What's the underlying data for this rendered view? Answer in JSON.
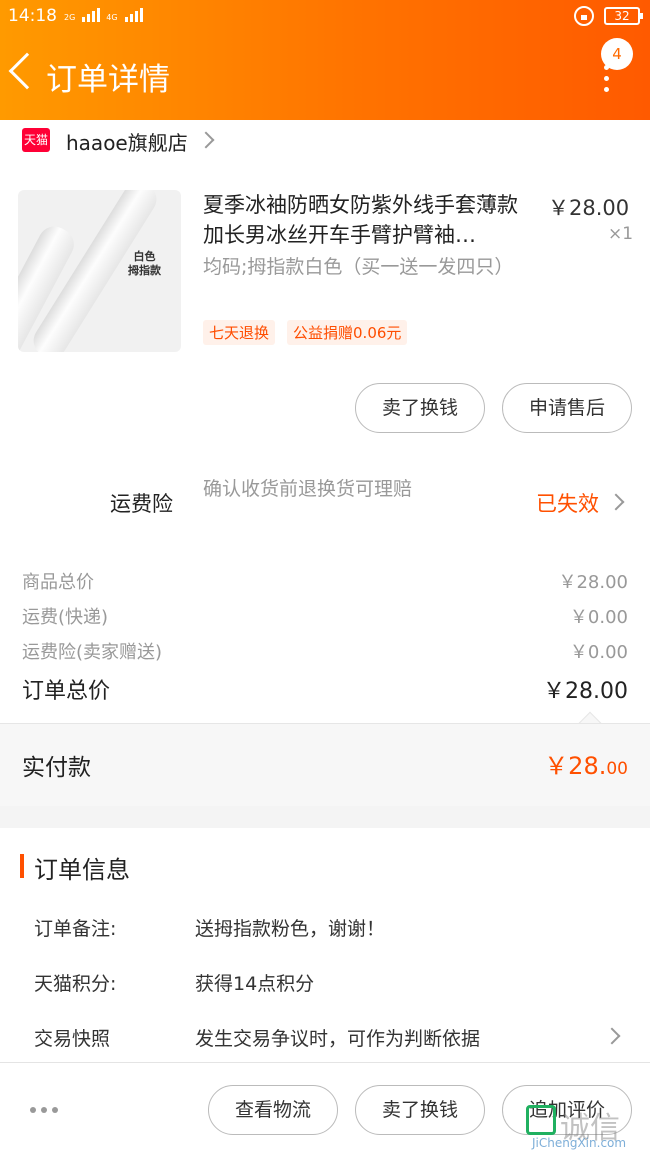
{
  "status_bar": {
    "time": "14:18",
    "net1": "2G",
    "net2": "4G",
    "battery": "32"
  },
  "header": {
    "title": "订单详情",
    "badge": "4"
  },
  "shop": {
    "logo_text": "天猫",
    "name": "haaoe旗舰店"
  },
  "product": {
    "title": "夏季冰袖防晒女防紫外线手套薄款加长男冰丝开车手臂护臂袖…",
    "price": "￥28.00",
    "qty": "×1",
    "sku": "均码;拇指款白色（买一送一发四只）",
    "image_label_line1": "白色",
    "image_label_line2": "拇指款",
    "tags": [
      "七天退换",
      "公益捐赠0.06元"
    ]
  },
  "item_actions": {
    "sell": "卖了换钱",
    "after_sale": "申请售后"
  },
  "insurance": {
    "label": "运费险",
    "desc": "确认收货前退换货可理赔",
    "status": "已失效"
  },
  "fees": [
    {
      "label": "商品总价",
      "value": "￥28.00"
    },
    {
      "label": "运费(快递)",
      "value": "￥0.00"
    },
    {
      "label": "运费险(卖家赠送)",
      "value": "￥0.00"
    }
  ],
  "order_total": {
    "label": "订单总价",
    "value": "￥28.00"
  },
  "payment": {
    "label": "实付款",
    "value_main": "￥28.",
    "value_decimal": "00"
  },
  "order_info": {
    "title": "订单信息",
    "rows": [
      {
        "key": "订单备注:",
        "value": "送拇指款粉色，谢谢！"
      },
      {
        "key": "天猫积分:",
        "value": "获得14点积分"
      },
      {
        "key": "交易快照",
        "value": "发生交易争议时，可作为判断依据"
      }
    ]
  },
  "bottom_actions": {
    "logistics": "查看物流",
    "sell": "卖了换钱",
    "review": "追加评价"
  },
  "watermark": {
    "cn": "诚信",
    "en": "JiChengXin.com"
  }
}
